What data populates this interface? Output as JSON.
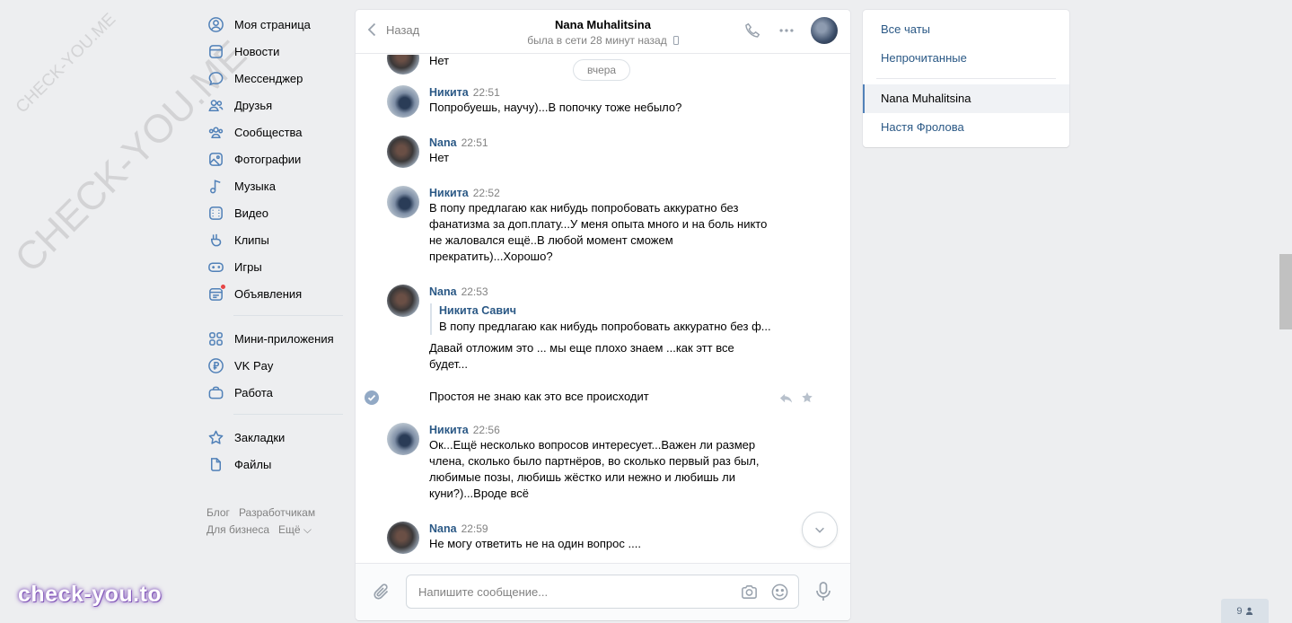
{
  "nav": {
    "main": [
      {
        "name": "nav-item-my-page",
        "icon": "user-circle-icon",
        "label": "Моя страница"
      },
      {
        "name": "nav-item-news",
        "icon": "newspaper-icon",
        "label": "Новости"
      },
      {
        "name": "nav-item-messenger",
        "icon": "chat-bubble-icon",
        "label": "Мессенджер"
      },
      {
        "name": "nav-item-friends",
        "icon": "users-icon",
        "label": "Друзья"
      },
      {
        "name": "nav-item-communities",
        "icon": "community-icon",
        "label": "Сообщества"
      },
      {
        "name": "nav-item-photos",
        "icon": "photo-icon",
        "label": "Фотографии"
      },
      {
        "name": "nav-item-music",
        "icon": "music-note-icon",
        "label": "Музыка"
      },
      {
        "name": "nav-item-video",
        "icon": "video-icon",
        "label": "Видео"
      },
      {
        "name": "nav-item-clips",
        "icon": "clips-icon",
        "label": "Клипы"
      },
      {
        "name": "nav-item-games",
        "icon": "gamepad-icon",
        "label": "Игры"
      },
      {
        "name": "nav-item-classifieds",
        "icon": "classifieds-icon",
        "label": "Объявления"
      }
    ],
    "secondary": [
      {
        "name": "nav-item-mini-apps",
        "icon": "grid-icon",
        "label": "Мини-приложения"
      },
      {
        "name": "nav-item-vkpay",
        "icon": "ruble-icon",
        "label": "VK Pay"
      },
      {
        "name": "nav-item-work",
        "icon": "briefcase-icon",
        "label": "Работа"
      }
    ],
    "tertiary": [
      {
        "name": "nav-item-bookmarks",
        "icon": "star-icon",
        "label": "Закладки"
      },
      {
        "name": "nav-item-files",
        "icon": "file-icon",
        "label": "Файлы"
      }
    ],
    "footer": {
      "blog": "Блог",
      "developers": "Разработчикам",
      "business": "Для бизнеса",
      "more": "Ещё ⌵"
    }
  },
  "watermark": {
    "small": "CHECK-YOU.ME",
    "large": "CHECK-YOU.ME",
    "brand": "check-you.to"
  },
  "chat": {
    "back_label": "Назад",
    "peer_name": "Nana Muhalitsina",
    "peer_status": "была в сети 28 минут назад",
    "date_chip": "вчера",
    "partial_text": "Нет",
    "selected_text": "Простоя не знаю как это все происходит",
    "messages": [
      {
        "author": "Никита",
        "time": "22:51",
        "lines": [
          "Попробуешь, научу)...В попочку тоже небыло?"
        ]
      },
      {
        "author": "Nana",
        "time": "22:51",
        "lines": [
          "Нет"
        ]
      },
      {
        "author": "Никита",
        "time": "22:52",
        "lines": [
          "В попу предлагаю как нибудь попробовать аккуратно без",
          "фанатизма за доп.плату...У меня опыта много и на боль никто",
          "не жаловался ещё..В любой момент сможем",
          "прекратить)...Хорошо?"
        ]
      },
      {
        "author": "Nana",
        "time": "22:53",
        "forward_author": "Никита Савич",
        "forward_text": "В попу предлагаю как нибудь попробовать аккуратно без ф...",
        "lines": [
          "Давай отложим это ... мы еще плохо знаем ...как этт все",
          "будет..."
        ]
      },
      {
        "author": "Никита",
        "time": "22:56",
        "lines": [
          "Ок...Ещё несколько вопросов интересует...Важен ли размер",
          "члена, сколько было партнёров, во сколько первый раз был,",
          "любимые позы, любишь жёстко или нежно и любишь ли",
          "куни?)...Вроде всё"
        ]
      },
      {
        "author": "Nana",
        "time": "22:59",
        "lines": [
          "Не могу ответить не на один вопрос ...."
        ]
      }
    ],
    "composer_placeholder": "Напишите сообщение..."
  },
  "right_panel": {
    "all_chats": "Все чаты",
    "unread": "Непрочитанные",
    "chats": [
      "Nana Muhalitsina",
      "Настя Фролова"
    ]
  },
  "online_count": "9"
}
